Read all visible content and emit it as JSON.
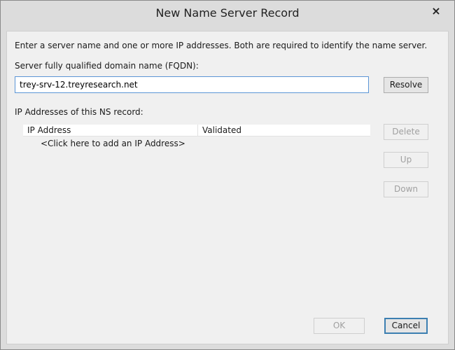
{
  "window": {
    "title": "New Name Server Record",
    "close_glyph": "×"
  },
  "dialog": {
    "instructions": "Enter a server name and one or more IP addresses.  Both are required to identify the name server.",
    "fqdn_label": "Server fully qualified domain name (FQDN):",
    "fqdn_value": "trey-srv-12.treyresearch.net",
    "resolve_label": "Resolve",
    "ip_section_label": "IP Addresses of this NS record:",
    "table": {
      "columns": [
        "IP Address",
        "Validated"
      ],
      "add_row_text": "<Click here to add an IP Address>"
    },
    "side_buttons": {
      "delete_label": "Delete",
      "up_label": "Up",
      "down_label": "Down"
    },
    "footer": {
      "ok_label": "OK",
      "cancel_label": "Cancel"
    }
  },
  "colors": {
    "window_frame": "#dcdcdc",
    "client_background": "#f0f0f0",
    "input_focus_border": "#5b95d6",
    "default_button_border": "#3c7fb1",
    "disabled_text": "#a0a0a0"
  }
}
